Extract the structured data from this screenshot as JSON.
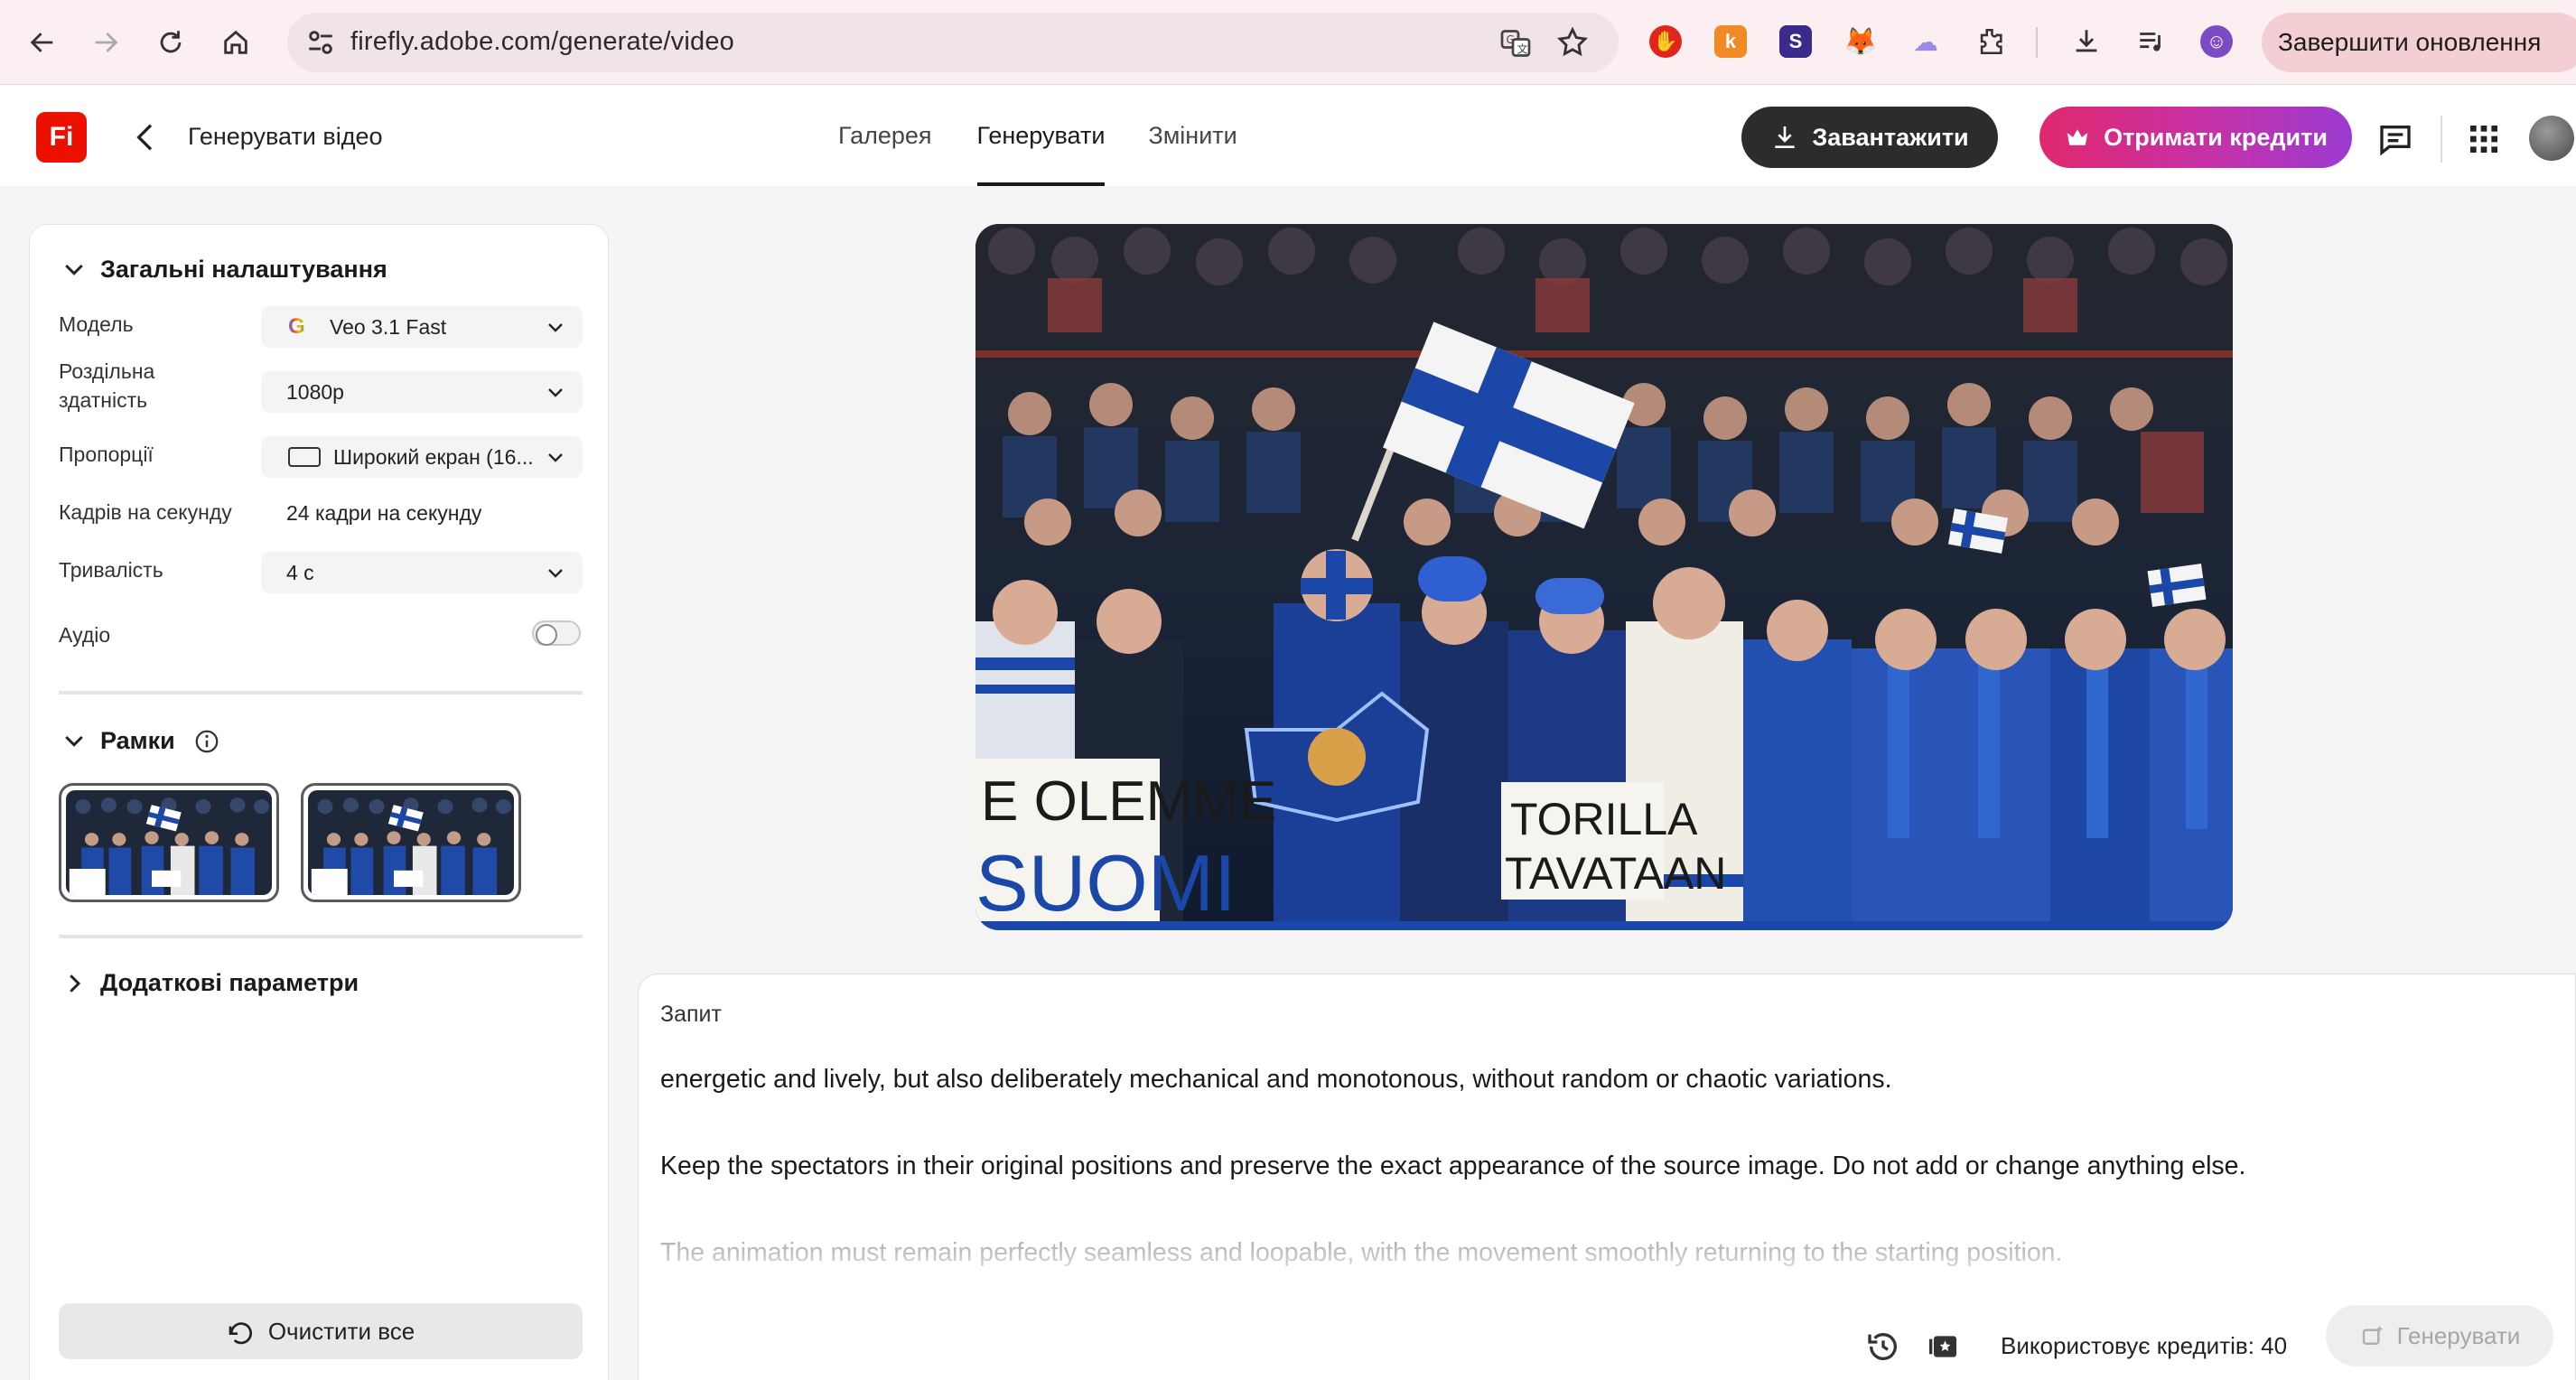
{
  "browser": {
    "url": "firefly.adobe.com/generate/video",
    "update_button": "Завершити оновлення"
  },
  "app": {
    "logo": "Fi",
    "page_title": "Генерувати відео",
    "tabs": [
      {
        "label": "Галерея",
        "active": false
      },
      {
        "label": "Генерувати",
        "active": true
      },
      {
        "label": "Змінити",
        "active": false
      }
    ],
    "download_label": "Завантажити",
    "credits_label": "Отримати кредити"
  },
  "settings": {
    "general_title": "Загальні налаштування",
    "model_label": "Модель",
    "model_value": "Veo 3.1 Fast",
    "resolution_label": "Роздільна здатність",
    "resolution_value": "1080p",
    "aspect_label": "Пропорції",
    "aspect_value": "Широкий екран (16...",
    "fps_label": "Кадрів на секунду",
    "fps_value": "24 кадри на секунду",
    "duration_label": "Тривалість",
    "duration_value": "4 с",
    "audio_label": "Аудіо",
    "audio_enabled": false,
    "frames_title": "Рамки",
    "advanced_title": "Додаткові параметри",
    "clear_label": "Очистити все"
  },
  "preview": {
    "sign_left_line1": "E OLEMME",
    "sign_left_line2": "SUOMI",
    "sign_right_line1": "TORILLA",
    "sign_right_line2": "TAVATAAN"
  },
  "prompt": {
    "label": "Запит",
    "paragraphs": [
      "energetic and lively, but also deliberately mechanical and monotonous, without random or chaotic variations.",
      "Keep the spectators in their original positions and preserve the exact appearance of the source image. Do not add or change anything else.",
      "The animation must remain perfectly seamless and loopable, with the movement smoothly returning to the starting position."
    ],
    "credits_used": "Використовує кредитів: 40",
    "generate_label": "Генерувати"
  },
  "colors": {
    "accent": "#eb1000",
    "dark_button": "#2c2c2c",
    "finnish_blue": "#1a47a8"
  }
}
